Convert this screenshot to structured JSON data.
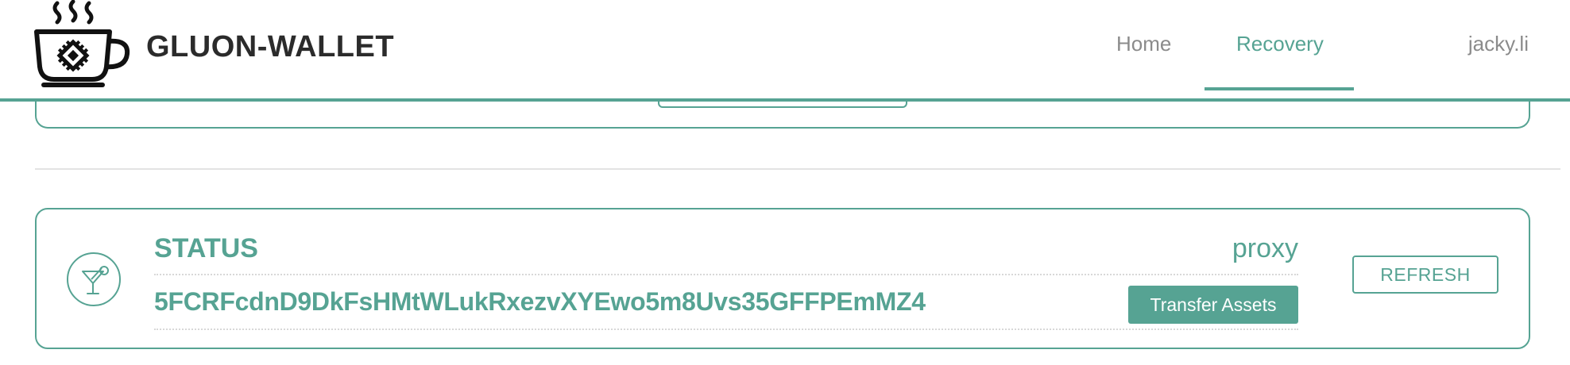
{
  "header": {
    "brand": "GLUON-WALLET",
    "logo_icon": "coffee-cup-chip-icon",
    "nav": {
      "home": "Home",
      "recovery": "Recovery",
      "user": "jacky.li"
    },
    "active_tab": "Recovery",
    "accent_color": "#56a393"
  },
  "status_card": {
    "icon": "cocktail-glass-icon",
    "title": "STATUS",
    "type": "proxy",
    "address": "5FCRFcdnD9DkFsHMtWLukRxezvXYEwo5m8Uvs35GFFPEmMZ4",
    "transfer_button": "Transfer Assets",
    "refresh_button": "REFRESH"
  }
}
